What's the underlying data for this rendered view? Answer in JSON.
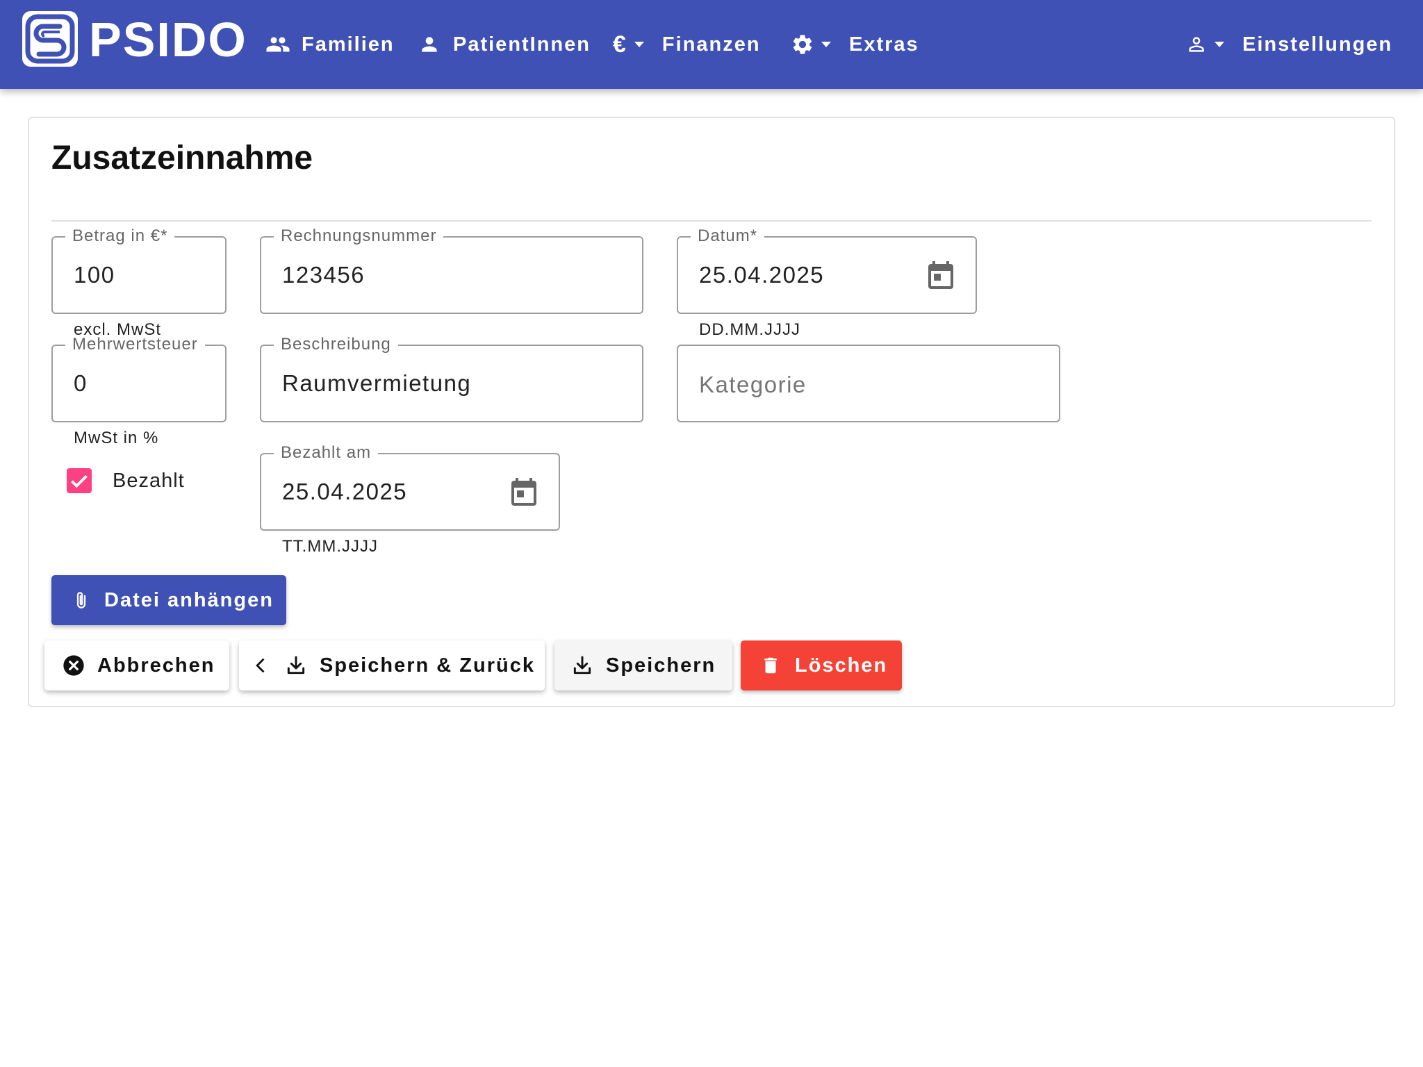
{
  "app": {
    "brand": "PSIDO",
    "nav": {
      "families": "Familien",
      "patients": "PatientInnen",
      "finances": "Finanzen",
      "extras": "Extras",
      "settings": "Einstellungen"
    }
  },
  "page": {
    "title": "Zusatzeinnahme"
  },
  "form": {
    "amount": {
      "label": "Betrag in €*",
      "value": "100",
      "hint": "excl. MwSt"
    },
    "invoice_number": {
      "label": "Rechnungsnummer",
      "value": "123456"
    },
    "date": {
      "label": "Datum*",
      "value": "25.04.2025",
      "hint": "DD.MM.JJJJ"
    },
    "vat": {
      "label": "Mehrwertsteuer",
      "value": "0",
      "hint": "MwSt in %"
    },
    "description": {
      "label": "Beschreibung",
      "value": "Raumvermietung"
    },
    "category": {
      "placeholder": "Kategorie"
    },
    "paid": {
      "label": "Bezahlt",
      "checked": true
    },
    "paid_on": {
      "label": "Bezahlt am",
      "value": "25.04.2025",
      "hint": "TT.MM.JJJJ"
    }
  },
  "actions": {
    "attach": "Datei anhängen",
    "cancel": "Abbrechen",
    "save_back": "Speichern & Zurück",
    "save": "Speichern",
    "delete": "Löschen"
  },
  "colors": {
    "primary": "#3f51b5",
    "accent": "#ff4081",
    "danger": "#f44336"
  }
}
